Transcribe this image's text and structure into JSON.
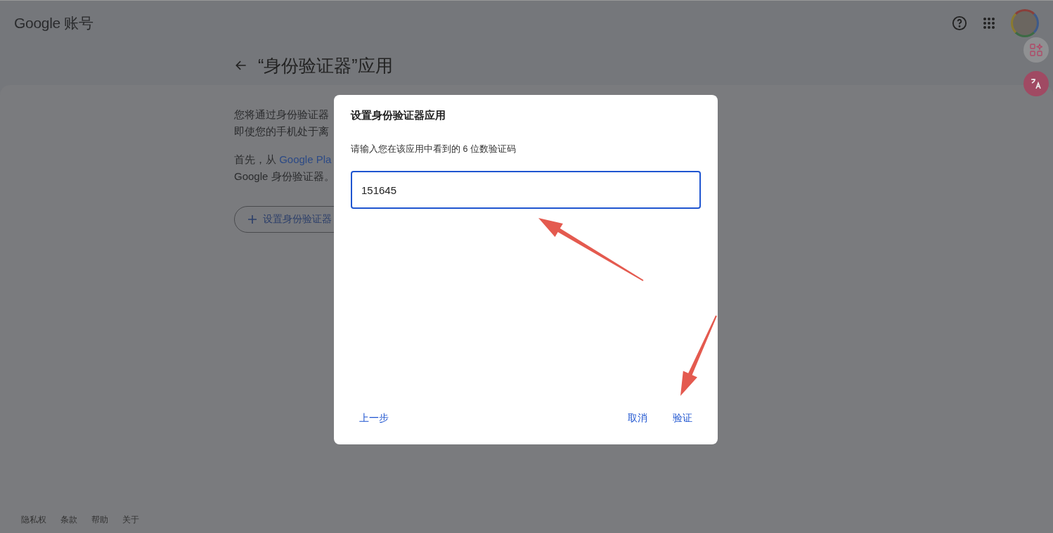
{
  "header": {
    "logo": "Google 账号"
  },
  "page": {
    "title": "“身份验证器”应用",
    "paragraphs": [
      {
        "lines": [
          {
            "text": "您将通过身份验证器"
          },
          {
            "text": "即使您的手机处于离"
          }
        ]
      },
      {
        "lines": [
          {
            "text": "首先，从 ",
            "link": "Google Pla"
          },
          {
            "text": "Google 身份验证器。"
          }
        ]
      }
    ],
    "setup_button": "设置身份验证器"
  },
  "dialog": {
    "title": "设置身份验证器应用",
    "instruction": "请输入您在该应用中看到的 6 位数验证码",
    "input_value": "151645",
    "focused": true,
    "back_button": "上一步",
    "buttons": [
      "取消",
      "验证"
    ]
  },
  "footer": {
    "links": [
      "隐私权",
      "条款",
      "帮助",
      "关于"
    ]
  }
}
